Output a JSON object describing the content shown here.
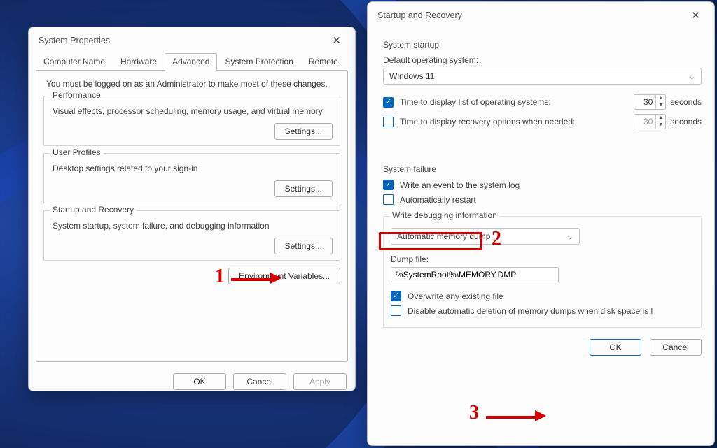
{
  "left": {
    "title": "System Properties",
    "tabs": [
      "Computer Name",
      "Hardware",
      "Advanced",
      "System Protection",
      "Remote"
    ],
    "active_tab": 2,
    "note": "You must be logged on as an Administrator to make most of these changes.",
    "groups": {
      "performance": {
        "legend": "Performance",
        "desc": "Visual effects, processor scheduling, memory usage, and virtual memory",
        "btn": "Settings..."
      },
      "profiles": {
        "legend": "User Profiles",
        "desc": "Desktop settings related to your sign-in",
        "btn": "Settings..."
      },
      "startup": {
        "legend": "Startup and Recovery",
        "desc": "System startup, system failure, and debugging information",
        "btn": "Settings..."
      }
    },
    "env_btn": "Environment Variables...",
    "footer": {
      "ok": "OK",
      "cancel": "Cancel",
      "apply": "Apply"
    }
  },
  "right": {
    "title": "Startup and Recovery",
    "startup": {
      "heading": "System startup",
      "default_os_label": "Default operating system:",
      "default_os_value": "Windows 11",
      "opt1_label": "Time to display list of operating systems:",
      "opt1_checked": true,
      "opt1_value": "30",
      "opt2_label": "Time to display recovery options when needed:",
      "opt2_checked": false,
      "opt2_value": "30",
      "seconds": "seconds"
    },
    "failure": {
      "heading": "System failure",
      "writelog_label": "Write an event to the system log",
      "writelog_checked": true,
      "autorestart_label": "Automatically restart",
      "autorestart_checked": false,
      "debug_legend": "Write debugging information",
      "debug_value": "Automatic memory dump",
      "dumpfile_label": "Dump file:",
      "dumpfile_value": "%SystemRoot%\\MEMORY.DMP",
      "overwrite_label": "Overwrite any existing file",
      "overwrite_checked": true,
      "disabledel_label": "Disable automatic deletion of memory dumps when disk space is l",
      "disabledel_checked": false
    },
    "footer": {
      "ok": "OK",
      "cancel": "Cancel"
    }
  },
  "annotations": {
    "n1": "1",
    "n2": "2",
    "n3": "3"
  }
}
